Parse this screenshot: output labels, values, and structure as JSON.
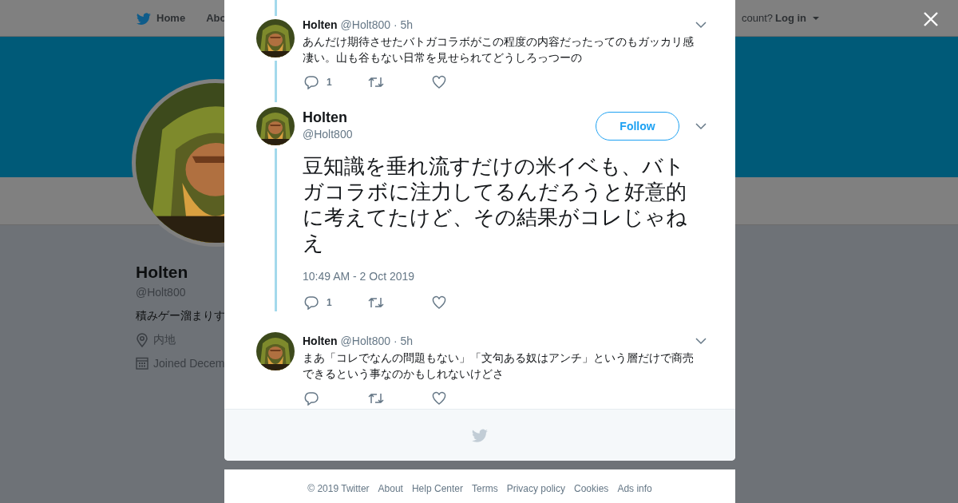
{
  "nav": {
    "home": "Home",
    "about": "Abo",
    "account_prompt": "count?",
    "login": "Log in"
  },
  "profile": {
    "name": "Holten",
    "handle": "@Holt800",
    "bio": "積みゲー溜まりす",
    "location": "内地",
    "joined": "Joined Decem"
  },
  "tweets": [
    {
      "kind": "reply",
      "name": "Holten",
      "handle": "@Holt800",
      "time": "· 5h",
      "text": "あんだけ期待させたバトガコラボがこの程度の内容だったってのもガッカリ感凄い。山も谷もない日常を見せられてどうしろっつーの",
      "replies": "1",
      "connected_above": true,
      "connected_below": true
    },
    {
      "kind": "main",
      "name": "Holten",
      "handle": "@Holt800",
      "follow": "Follow",
      "text": "豆知識を垂れ流すだけの米イベも、バトガコラボに注力してるんだろうと好意的に考えてたけど、その結果がコレじゃねえ",
      "timestamp": "10:49 AM - 2 Oct 2019",
      "replies": "1",
      "connected_above": false,
      "connected_below": true
    },
    {
      "kind": "reply",
      "name": "Holten",
      "handle": "@Holt800",
      "time": "· 5h",
      "text": "まあ「コレでなんの問題もない」「文句ある奴はアンチ」という層だけで商売できるという事なのかもしれないけどさ",
      "connected_above": false,
      "connected_below": false
    }
  ],
  "footer_links": [
    "© 2019 Twitter",
    "About",
    "Help Center",
    "Terms",
    "Privacy policy",
    "Cookies",
    "Ads info"
  ]
}
